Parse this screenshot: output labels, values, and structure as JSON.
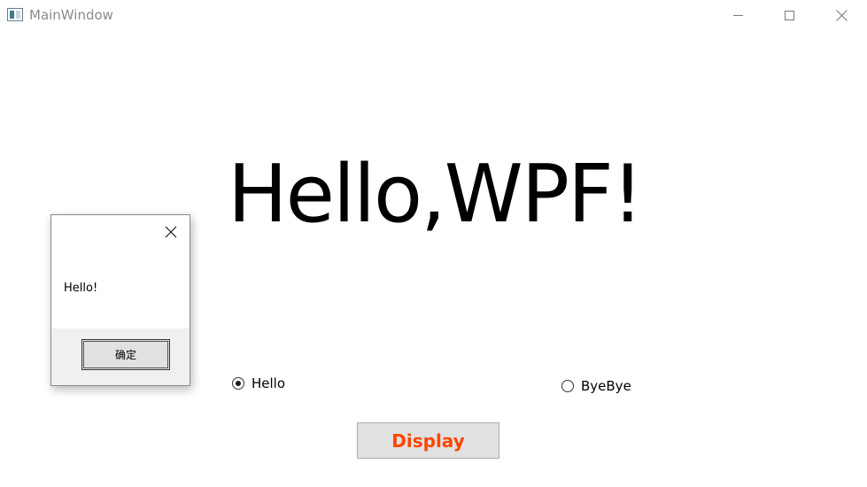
{
  "window": {
    "title": "MainWindow",
    "app_icon": "window-app-icon",
    "controls": [
      "minimize-icon",
      "maximize-icon",
      "close-icon"
    ]
  },
  "main": {
    "headline": "Hello,WPF!",
    "radio_options": [
      {
        "label": "Hello",
        "checked": true
      },
      {
        "label": "ByeBye",
        "checked": false
      }
    ],
    "display_button": {
      "label": "Display",
      "color": "#ff4500"
    }
  },
  "message_box": {
    "message": "Hello!",
    "ok_label": "确定",
    "close_icon": "close-icon"
  }
}
